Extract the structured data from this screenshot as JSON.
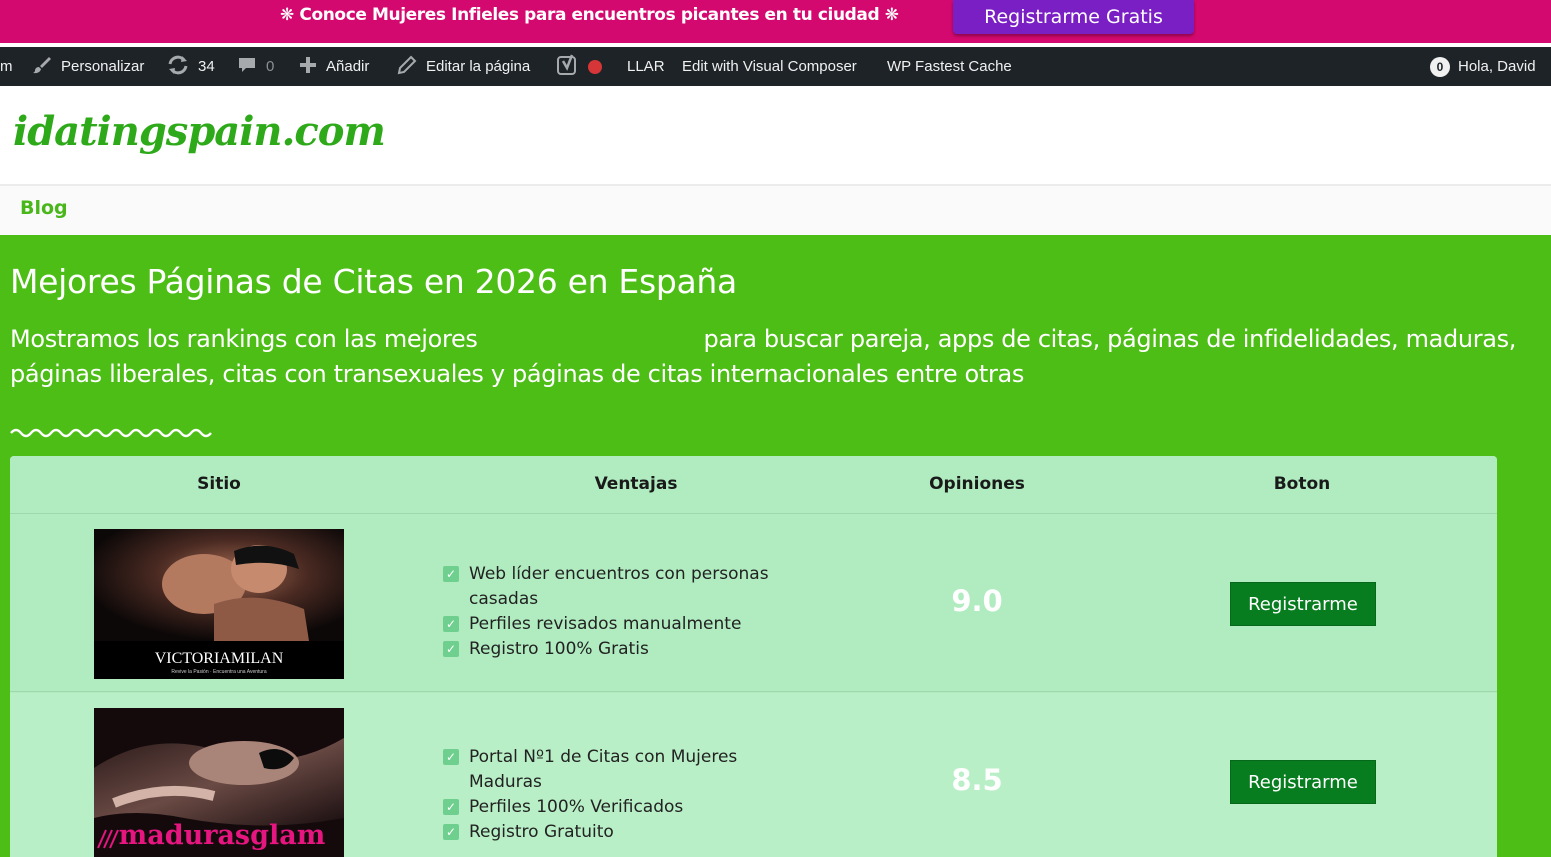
{
  "promo": {
    "text": "❋ Conoce Mujeres Infieles para encuentros picantes en tu ciudad ❋",
    "button": "Registrarme Gratis"
  },
  "adminbar": {
    "left_stub": "m",
    "personalizar": "Personalizar",
    "updates": "34",
    "comments": "0",
    "add": "Añadir",
    "edit_page": "Editar la página",
    "llar": "LLAR",
    "visual_composer": "Edit with Visual Composer",
    "fastest_cache": "WP Fastest Cache",
    "notif_count": "0",
    "greeting": "Hola, David"
  },
  "site": {
    "logo": "idatingspain.com",
    "nav_blog": "Blog"
  },
  "hero": {
    "title": "Mejores Páginas de Citas en 2026 en España",
    "lead_part1": "Mostramos los rankings con las mejores",
    "lead_part2": "para buscar pareja, apps de citas, páginas de infidelidades, maduras, páginas liberales, citas con transexuales y páginas de citas internacionales entre otras"
  },
  "table": {
    "headers": [
      "Sitio",
      "Ventajas",
      "Opiniones",
      "Boton"
    ],
    "rows": [
      {
        "brand": "VICTORIAMILAN",
        "tagline": "Revive la Pasión · Encuentra una Aventura",
        "features": [
          "Web líder encuentros con personas casadas",
          "Perfiles revisados manualmente",
          "Registro 100% Gratis"
        ],
        "score": "9.0",
        "button": "Registrarme"
      },
      {
        "brand": "madurasglam",
        "features": [
          "Portal Nº1 de Citas con Mujeres Maduras",
          "Perfiles 100% Verificados",
          "Registro Gratuito"
        ],
        "score": "8.5",
        "button": "Registrarme"
      }
    ]
  },
  "colors": {
    "promo_bg": "#d4096f",
    "promo_button": "#7a1fc4",
    "adminbar_bg": "#1d2327",
    "page_green": "#4cbe15",
    "logo_green": "#2ea91a",
    "table_bg": "#b0ecc0",
    "cta_green": "#087d1f"
  }
}
